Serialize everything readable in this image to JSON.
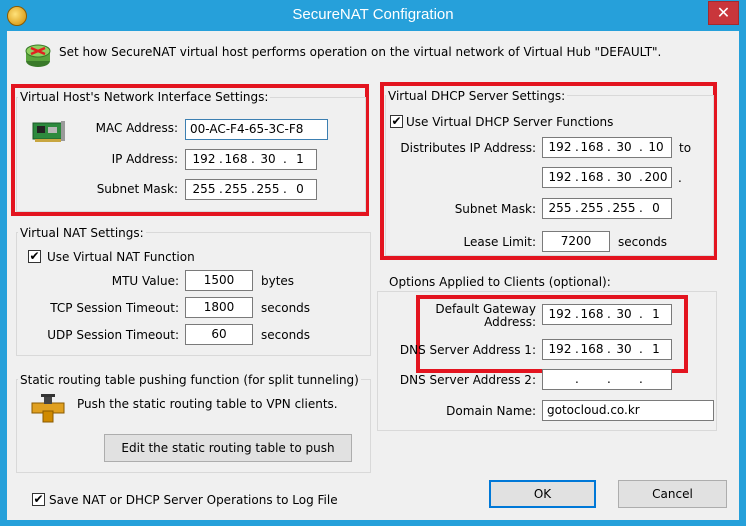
{
  "window": {
    "title": "SecureNAT Configration",
    "close_glyph": "✕"
  },
  "intro": {
    "text": "Set how SecureNAT virtual host performs operation on the virtual network of Virtual Hub \"DEFAULT\"."
  },
  "host": {
    "legend": "Virtual Host's Network Interface Settings:",
    "mac_label": "MAC Address:",
    "mac_value": "00-AC-F4-65-3C-F8",
    "ip_label": "IP Address:",
    "ip": [
      "192",
      "168",
      "30",
      "1"
    ],
    "mask_label": "Subnet Mask:",
    "mask": [
      "255",
      "255",
      "255",
      "0"
    ]
  },
  "nat": {
    "legend": "Virtual NAT Settings:",
    "use_label": "Use Virtual NAT Function",
    "use_checked": "✔",
    "mtu_label": "MTU Value:",
    "mtu_value": "1500",
    "mtu_unit": "bytes",
    "tcp_label": "TCP Session Timeout:",
    "tcp_value": "1800",
    "tcp_unit": "seconds",
    "udp_label": "UDP Session Timeout:",
    "udp_value": "60",
    "udp_unit": "seconds"
  },
  "static_route": {
    "legend": "Static routing table pushing function (for split tunneling)",
    "text": "Push the static routing table to VPN clients.",
    "button": "Edit the static routing table to push"
  },
  "log": {
    "label": "Save NAT or DHCP Server Operations to Log File",
    "checked": "✔"
  },
  "dhcp": {
    "legend": "Virtual DHCP Server Settings:",
    "use_label": "Use Virtual DHCP Server Functions",
    "use_checked": "✔",
    "range_label": "Distributes IP Address:",
    "range_start": [
      "192",
      "168",
      "30",
      "10"
    ],
    "to_label": "to",
    "range_end": [
      "192",
      "168",
      "30",
      "200"
    ],
    "range_end_suffix": ".",
    "mask_label": "Subnet Mask:",
    "mask": [
      "255",
      "255",
      "255",
      "0"
    ],
    "lease_label": "Lease Limit:",
    "lease_value": "7200",
    "lease_unit": "seconds"
  },
  "options": {
    "title": "Options Applied to Clients (optional):",
    "gw_label": "Default Gateway Address:",
    "gw": [
      "192",
      "168",
      "30",
      "1"
    ],
    "dns1_label": "DNS Server Address 1:",
    "dns1": [
      "192",
      "168",
      "30",
      "1"
    ],
    "dns2_label": "DNS Server Address 2:",
    "dns2": [
      "",
      "",
      "",
      ""
    ],
    "domain_label": "Domain Name:",
    "domain_value": "gotocloud.co.kr"
  },
  "buttons": {
    "ok": "OK",
    "cancel": "Cancel"
  },
  "colors": {
    "titlebar": "#26a0da",
    "highlight_box": "#e3141f",
    "close": "#c9363b"
  },
  "icons": [
    "router-icon",
    "network-card-icon",
    "pipe-junction-icon",
    "close-icon",
    "checkbox-check-icon"
  ]
}
